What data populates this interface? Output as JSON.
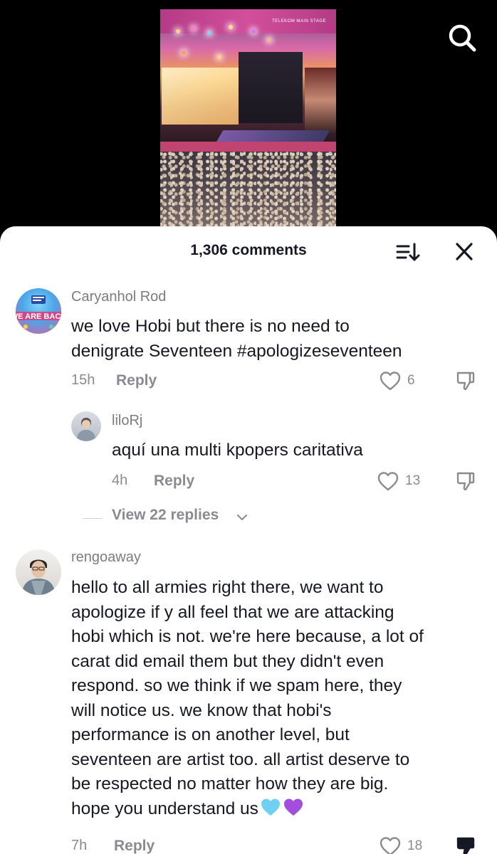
{
  "video": {
    "stage_label": "TELEKOM MAIN STAGE"
  },
  "sheet": {
    "comment_count": "1,306 comments"
  },
  "comments": [
    {
      "username": "Caryanhol Rod",
      "avatar_text": "WE ARE BACK",
      "lines": [
        "we love Hobi but there is no need to",
        "denigrate Seventeen #apologizeseventeen"
      ],
      "time": "15h",
      "reply_label": "Reply",
      "likes": "6"
    },
    {
      "username": "liloRj",
      "lines": [
        "aquí una multi kpopers caritativa"
      ],
      "time": "4h",
      "reply_label": "Reply",
      "likes": "13"
    },
    {
      "username": "rengoaway",
      "lines": [
        "hello to all armies right there, we want to",
        "apologize if y all feel that we are attacking",
        "hobi which is not. we're here because, a lot of",
        "carat did email them but they didn't even",
        "respond. so we think if we spam here, they",
        "will notice us. we know that hobi's",
        "performance is on another level, but",
        "seventeen are artist too. all artist deserve to",
        "be respected no matter how they are big.",
        "hope you understand us"
      ],
      "time": "7h",
      "reply_label": "Reply",
      "likes": "18"
    }
  ],
  "view_replies": "View 22 replies",
  "icons": {
    "search": "search-icon",
    "sort": "sort-icon",
    "close": "close-icon",
    "like": "heart-outline-icon",
    "dislike": "thumbs-down-icon",
    "heart_emojis": [
      "light-blue-heart-emoji",
      "purple-heart-emoji"
    ]
  },
  "colors": {
    "text_primary": "#161823",
    "text_secondary": "#8a8b91",
    "light_blue_heart": "#6fd0f2",
    "purple_heart": "#a24ddb"
  }
}
